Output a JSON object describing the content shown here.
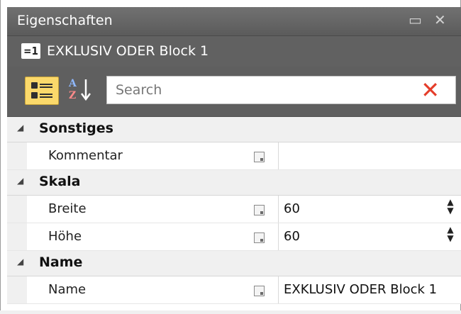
{
  "panel": {
    "title": "Eigenschaften",
    "restore_glyph": "▭",
    "close_glyph": "✕"
  },
  "object": {
    "icon_text": "=1",
    "name": "EXKLUSIV ODER Block 1"
  },
  "toolbar": {
    "categorized_icon": "categorized-view-icon",
    "alphabetical_icon": "sort-alphabetical-icon",
    "search_placeholder": "Search",
    "clear_glyph": "✕",
    "categorized_active": true
  },
  "categories": [
    {
      "name": "Sonstiges",
      "properties": [
        {
          "name": "Kommentar",
          "value": ""
        }
      ]
    },
    {
      "name": "Skala",
      "properties": [
        {
          "name": "Breite",
          "value": "60"
        },
        {
          "name": "Höhe",
          "value": "60"
        }
      ]
    },
    {
      "name": "Name",
      "properties": [
        {
          "name": "Name",
          "value": "EXKLUSIV ODER Block 1"
        }
      ]
    }
  ],
  "colors": {
    "titlebar": "#686868",
    "toolbar": "#5f5f5f",
    "active_button": "#fbd96b",
    "clear_icon": "#e53d2a"
  }
}
